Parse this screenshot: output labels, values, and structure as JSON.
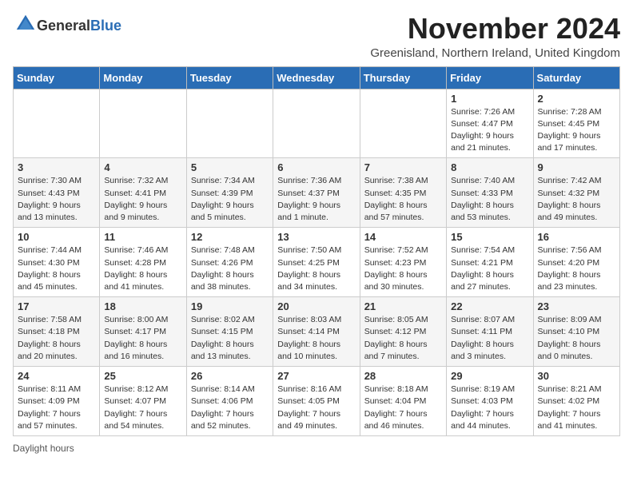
{
  "header": {
    "logo_general": "General",
    "logo_blue": "Blue",
    "month_title": "November 2024",
    "location": "Greenisland, Northern Ireland, United Kingdom"
  },
  "columns": [
    "Sunday",
    "Monday",
    "Tuesday",
    "Wednesday",
    "Thursday",
    "Friday",
    "Saturday"
  ],
  "weeks": [
    [
      {
        "day": "",
        "sunrise": "",
        "sunset": "",
        "daylight": ""
      },
      {
        "day": "",
        "sunrise": "",
        "sunset": "",
        "daylight": ""
      },
      {
        "day": "",
        "sunrise": "",
        "sunset": "",
        "daylight": ""
      },
      {
        "day": "",
        "sunrise": "",
        "sunset": "",
        "daylight": ""
      },
      {
        "day": "",
        "sunrise": "",
        "sunset": "",
        "daylight": ""
      },
      {
        "day": "1",
        "sunrise": "Sunrise: 7:26 AM",
        "sunset": "Sunset: 4:47 PM",
        "daylight": "Daylight: 9 hours and 21 minutes."
      },
      {
        "day": "2",
        "sunrise": "Sunrise: 7:28 AM",
        "sunset": "Sunset: 4:45 PM",
        "daylight": "Daylight: 9 hours and 17 minutes."
      }
    ],
    [
      {
        "day": "3",
        "sunrise": "Sunrise: 7:30 AM",
        "sunset": "Sunset: 4:43 PM",
        "daylight": "Daylight: 9 hours and 13 minutes."
      },
      {
        "day": "4",
        "sunrise": "Sunrise: 7:32 AM",
        "sunset": "Sunset: 4:41 PM",
        "daylight": "Daylight: 9 hours and 9 minutes."
      },
      {
        "day": "5",
        "sunrise": "Sunrise: 7:34 AM",
        "sunset": "Sunset: 4:39 PM",
        "daylight": "Daylight: 9 hours and 5 minutes."
      },
      {
        "day": "6",
        "sunrise": "Sunrise: 7:36 AM",
        "sunset": "Sunset: 4:37 PM",
        "daylight": "Daylight: 9 hours and 1 minute."
      },
      {
        "day": "7",
        "sunrise": "Sunrise: 7:38 AM",
        "sunset": "Sunset: 4:35 PM",
        "daylight": "Daylight: 8 hours and 57 minutes."
      },
      {
        "day": "8",
        "sunrise": "Sunrise: 7:40 AM",
        "sunset": "Sunset: 4:33 PM",
        "daylight": "Daylight: 8 hours and 53 minutes."
      },
      {
        "day": "9",
        "sunrise": "Sunrise: 7:42 AM",
        "sunset": "Sunset: 4:32 PM",
        "daylight": "Daylight: 8 hours and 49 minutes."
      }
    ],
    [
      {
        "day": "10",
        "sunrise": "Sunrise: 7:44 AM",
        "sunset": "Sunset: 4:30 PM",
        "daylight": "Daylight: 8 hours and 45 minutes."
      },
      {
        "day": "11",
        "sunrise": "Sunrise: 7:46 AM",
        "sunset": "Sunset: 4:28 PM",
        "daylight": "Daylight: 8 hours and 41 minutes."
      },
      {
        "day": "12",
        "sunrise": "Sunrise: 7:48 AM",
        "sunset": "Sunset: 4:26 PM",
        "daylight": "Daylight: 8 hours and 38 minutes."
      },
      {
        "day": "13",
        "sunrise": "Sunrise: 7:50 AM",
        "sunset": "Sunset: 4:25 PM",
        "daylight": "Daylight: 8 hours and 34 minutes."
      },
      {
        "day": "14",
        "sunrise": "Sunrise: 7:52 AM",
        "sunset": "Sunset: 4:23 PM",
        "daylight": "Daylight: 8 hours and 30 minutes."
      },
      {
        "day": "15",
        "sunrise": "Sunrise: 7:54 AM",
        "sunset": "Sunset: 4:21 PM",
        "daylight": "Daylight: 8 hours and 27 minutes."
      },
      {
        "day": "16",
        "sunrise": "Sunrise: 7:56 AM",
        "sunset": "Sunset: 4:20 PM",
        "daylight": "Daylight: 8 hours and 23 minutes."
      }
    ],
    [
      {
        "day": "17",
        "sunrise": "Sunrise: 7:58 AM",
        "sunset": "Sunset: 4:18 PM",
        "daylight": "Daylight: 8 hours and 20 minutes."
      },
      {
        "day": "18",
        "sunrise": "Sunrise: 8:00 AM",
        "sunset": "Sunset: 4:17 PM",
        "daylight": "Daylight: 8 hours and 16 minutes."
      },
      {
        "day": "19",
        "sunrise": "Sunrise: 8:02 AM",
        "sunset": "Sunset: 4:15 PM",
        "daylight": "Daylight: 8 hours and 13 minutes."
      },
      {
        "day": "20",
        "sunrise": "Sunrise: 8:03 AM",
        "sunset": "Sunset: 4:14 PM",
        "daylight": "Daylight: 8 hours and 10 minutes."
      },
      {
        "day": "21",
        "sunrise": "Sunrise: 8:05 AM",
        "sunset": "Sunset: 4:12 PM",
        "daylight": "Daylight: 8 hours and 7 minutes."
      },
      {
        "day": "22",
        "sunrise": "Sunrise: 8:07 AM",
        "sunset": "Sunset: 4:11 PM",
        "daylight": "Daylight: 8 hours and 3 minutes."
      },
      {
        "day": "23",
        "sunrise": "Sunrise: 8:09 AM",
        "sunset": "Sunset: 4:10 PM",
        "daylight": "Daylight: 8 hours and 0 minutes."
      }
    ],
    [
      {
        "day": "24",
        "sunrise": "Sunrise: 8:11 AM",
        "sunset": "Sunset: 4:09 PM",
        "daylight": "Daylight: 7 hours and 57 minutes."
      },
      {
        "day": "25",
        "sunrise": "Sunrise: 8:12 AM",
        "sunset": "Sunset: 4:07 PM",
        "daylight": "Daylight: 7 hours and 54 minutes."
      },
      {
        "day": "26",
        "sunrise": "Sunrise: 8:14 AM",
        "sunset": "Sunset: 4:06 PM",
        "daylight": "Daylight: 7 hours and 52 minutes."
      },
      {
        "day": "27",
        "sunrise": "Sunrise: 8:16 AM",
        "sunset": "Sunset: 4:05 PM",
        "daylight": "Daylight: 7 hours and 49 minutes."
      },
      {
        "day": "28",
        "sunrise": "Sunrise: 8:18 AM",
        "sunset": "Sunset: 4:04 PM",
        "daylight": "Daylight: 7 hours and 46 minutes."
      },
      {
        "day": "29",
        "sunrise": "Sunrise: 8:19 AM",
        "sunset": "Sunset: 4:03 PM",
        "daylight": "Daylight: 7 hours and 44 minutes."
      },
      {
        "day": "30",
        "sunrise": "Sunrise: 8:21 AM",
        "sunset": "Sunset: 4:02 PM",
        "daylight": "Daylight: 7 hours and 41 minutes."
      }
    ]
  ],
  "legend": {
    "daylight_hours": "Daylight hours"
  }
}
